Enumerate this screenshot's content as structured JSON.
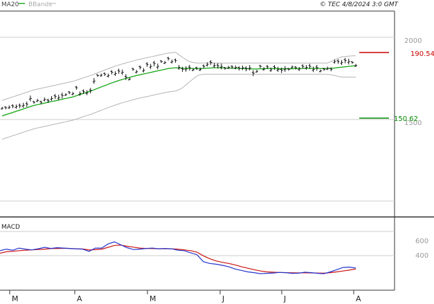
{
  "legend": {
    "ma_label": "MA20",
    "bb_label": "BBands",
    "ma_color": "#22aa22",
    "bb_color": "#b4b4b4"
  },
  "copyright": "© TEC 4/8/2024 3:0 GMT",
  "panels": {
    "macd_label": "MACD"
  },
  "colors": {
    "grid": "#cccccc",
    "frame": "#222222",
    "bars": "#111111",
    "resistance": "#cc0000",
    "support": "#008800",
    "macd": "#2233cc",
    "signal": "#cc1111"
  },
  "chart_data": [
    {
      "type": "line",
      "title": "",
      "price_axis_ticks": [
        "2000",
        "1500"
      ],
      "ylim": [
        1080,
        2140
      ],
      "x_tick_labels": [
        "M",
        "A",
        "M",
        "J",
        "J",
        "A"
      ],
      "levels": {
        "resistance": {
          "value": 190.54,
          "label": "190.54"
        },
        "support": {
          "value": 150.62,
          "label": "150.62"
        }
      },
      "series": [
        {
          "kind": "price_bars",
          "values": [
            1640,
            1642,
            1645,
            1650,
            1648,
            1652,
            1655,
            1660,
            1690,
            1670,
            1680,
            1670,
            1685,
            1678,
            1690,
            1700,
            1695,
            1705,
            1710,
            1720,
            1715,
            1745,
            1715,
            1725,
            1720,
            1730,
            1780,
            1808,
            1810,
            1815,
            1808,
            1825,
            1818,
            1830,
            1825,
            1800,
            1790,
            1840,
            1828,
            1850,
            1835,
            1865,
            1855,
            1870,
            1855,
            1880,
            1875,
            1895,
            1880,
            1885,
            1850,
            1840,
            1842,
            1848,
            1838,
            1845,
            1840,
            1855,
            1865,
            1875,
            1860,
            1858,
            1855,
            1845,
            1850,
            1852,
            1850,
            1845,
            1848,
            1843,
            1848,
            1820,
            1830,
            1855,
            1842,
            1852,
            1838,
            1850,
            1840,
            1835,
            1842,
            1840,
            1852,
            1848,
            1842,
            1855,
            1850,
            1855,
            1840,
            1848,
            1832,
            1840,
            1845,
            1840,
            1880,
            1880,
            1875,
            1885,
            1880,
            1875,
            1860
          ]
        },
        {
          "name": "MA20",
          "values": [
            1600,
            1606,
            1612,
            1618,
            1624,
            1630,
            1636,
            1642,
            1648,
            1654,
            1658,
            1662,
            1666,
            1670,
            1674,
            1678,
            1682,
            1686,
            1690,
            1694,
            1698,
            1704,
            1710,
            1716,
            1722,
            1728,
            1735,
            1742,
            1749,
            1756,
            1763,
            1770,
            1776,
            1782,
            1788,
            1793,
            1798,
            1803,
            1808,
            1812,
            1816,
            1820,
            1824,
            1828,
            1832,
            1836,
            1840,
            1844,
            1846,
            1848,
            1847,
            1846,
            1845,
            1845,
            1844,
            1844,
            1844,
            1845,
            1846,
            1847,
            1848,
            1848,
            1848,
            1847,
            1846,
            1846,
            1845,
            1845,
            1844,
            1843,
            1843,
            1842,
            1842,
            1843,
            1843,
            1844,
            1844,
            1844,
            1843,
            1843,
            1843,
            1843,
            1843,
            1844,
            1844,
            1845,
            1845,
            1845,
            1845,
            1845,
            1844,
            1844,
            1844,
            1845,
            1847,
            1849,
            1851,
            1853,
            1855,
            1857,
            1859
          ]
        },
        {
          "name": "BB upper",
          "values": [
            1680,
            1686,
            1692,
            1698,
            1704,
            1710,
            1716,
            1722,
            1728,
            1734,
            1738,
            1742,
            1746,
            1750,
            1754,
            1758,
            1762,
            1766,
            1770,
            1774,
            1778,
            1784,
            1790,
            1796,
            1802,
            1808,
            1815,
            1822,
            1829,
            1836,
            1843,
            1850,
            1856,
            1862,
            1868,
            1873,
            1878,
            1883,
            1888,
            1892,
            1896,
            1900,
            1904,
            1908,
            1912,
            1916,
            1920,
            1924,
            1926,
            1928,
            1915,
            1902,
            1890,
            1880,
            1875,
            1872,
            1872,
            1872,
            1872,
            1872,
            1872,
            1872,
            1872,
            1872,
            1872,
            1872,
            1872,
            1872,
            1872,
            1872,
            1872,
            1872,
            1872,
            1872,
            1872,
            1872,
            1872,
            1872,
            1872,
            1872,
            1872,
            1872,
            1872,
            1872,
            1872,
            1872,
            1872,
            1872,
            1872,
            1872,
            1872,
            1872,
            1872,
            1880,
            1888,
            1896,
            1904,
            1906,
            1908,
            1910,
            1910
          ]
        },
        {
          "name": "BB lower",
          "values": [
            1480,
            1486,
            1492,
            1498,
            1504,
            1510,
            1516,
            1522,
            1528,
            1534,
            1538,
            1542,
            1546,
            1550,
            1554,
            1558,
            1562,
            1566,
            1570,
            1574,
            1578,
            1584,
            1590,
            1596,
            1602,
            1608,
            1615,
            1622,
            1629,
            1636,
            1643,
            1650,
            1656,
            1662,
            1668,
            1673,
            1678,
            1683,
            1688,
            1692,
            1696,
            1700,
            1704,
            1708,
            1712,
            1716,
            1720,
            1724,
            1726,
            1728,
            1735,
            1745,
            1760,
            1775,
            1790,
            1805,
            1812,
            1815,
            1815,
            1815,
            1815,
            1815,
            1815,
            1815,
            1815,
            1815,
            1815,
            1815,
            1815,
            1815,
            1815,
            1815,
            1815,
            1815,
            1815,
            1815,
            1815,
            1815,
            1815,
            1815,
            1815,
            1815,
            1815,
            1815,
            1815,
            1815,
            1815,
            1815,
            1815,
            1815,
            1815,
            1815,
            1815,
            1812,
            1808,
            1804,
            1800,
            1800,
            1800,
            1800,
            1800
          ]
        }
      ]
    },
    {
      "type": "line",
      "title": "MACD",
      "y_ticks": [
        "600",
        "400"
      ],
      "ylim": [
        0,
        1000
      ],
      "series": [
        {
          "name": "MACD",
          "values": [
            540,
            560,
            545,
            575,
            560,
            550,
            565,
            585,
            570,
            580,
            575,
            570,
            565,
            560,
            530,
            575,
            575,
            630,
            660,
            620,
            580,
            555,
            560,
            570,
            575,
            565,
            570,
            565,
            545,
            540,
            510,
            485,
            390,
            365,
            355,
            340,
            320,
            290,
            270,
            250,
            240,
            225,
            230,
            235,
            242,
            240,
            230,
            232,
            245,
            240,
            230,
            225,
            250,
            280,
            310,
            315,
            302
          ]
        },
        {
          "name": "Signal",
          "values": [
            505,
            525,
            530,
            540,
            545,
            550,
            555,
            560,
            568,
            570,
            572,
            570,
            565,
            562,
            550,
            553,
            560,
            585,
            610,
            615,
            600,
            588,
            575,
            570,
            568,
            566,
            566,
            564,
            560,
            550,
            540,
            520,
            470,
            430,
            400,
            380,
            365,
            345,
            320,
            300,
            280,
            262,
            250,
            245,
            242,
            240,
            238,
            236,
            238,
            236,
            234,
            232,
            240,
            250,
            262,
            275,
            290
          ]
        }
      ]
    }
  ]
}
